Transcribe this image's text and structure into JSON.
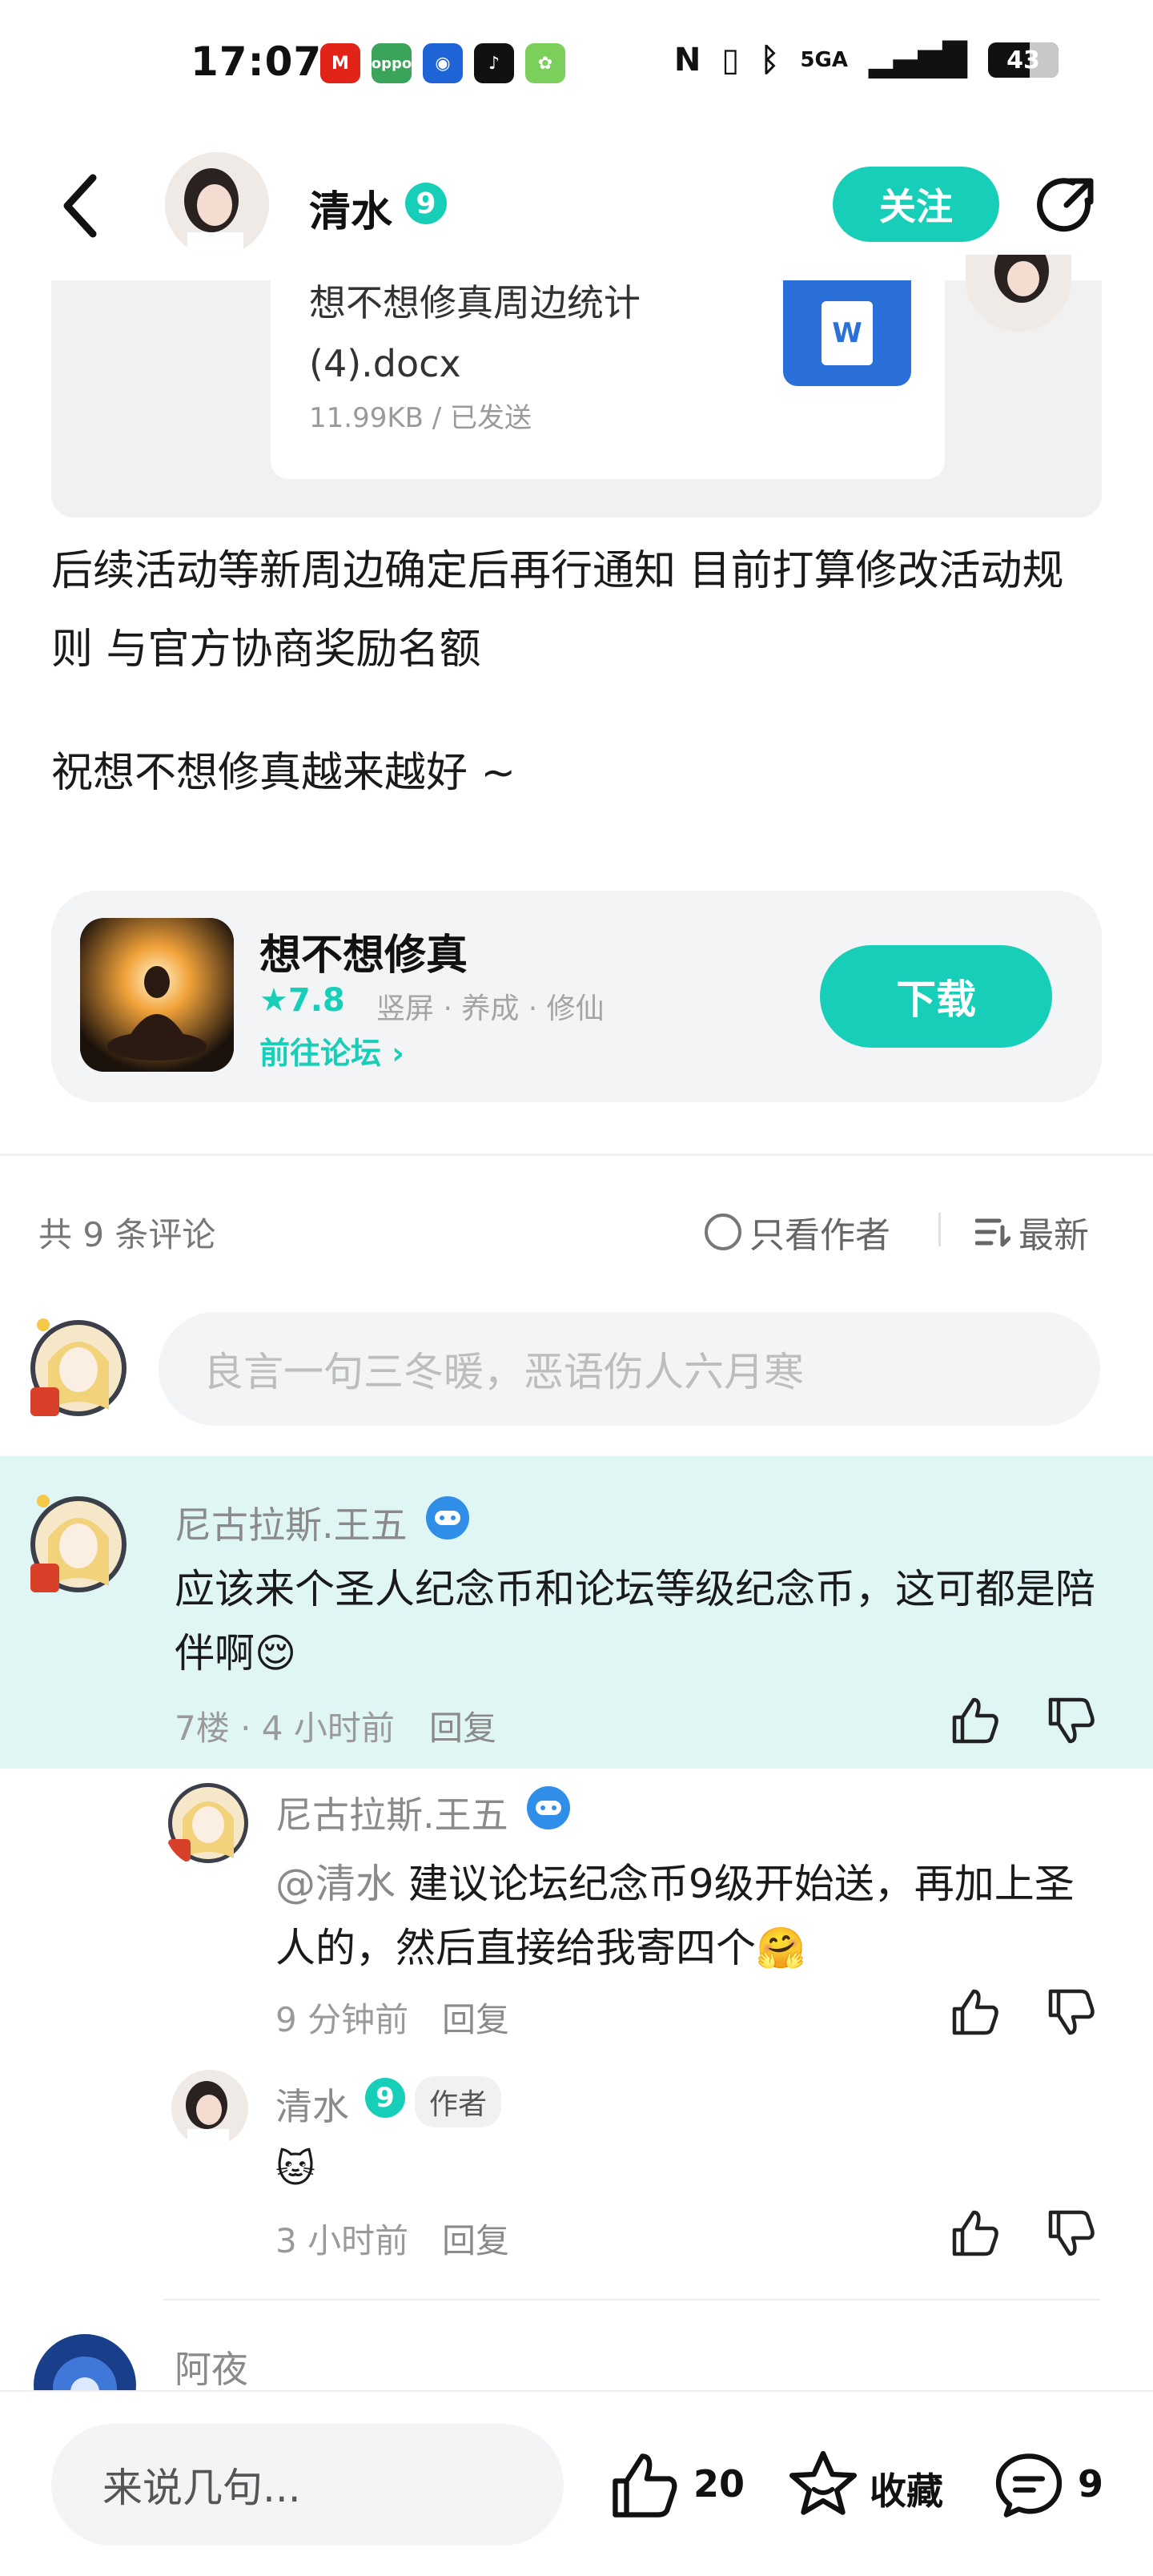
{
  "status_bar": {
    "time": "17:07",
    "apps": [
      {
        "name": "mcdonalds-icon",
        "color": "#e22318",
        "label": "M"
      },
      {
        "name": "oppo-icon",
        "color": "#3aa55a",
        "label": "oppo"
      },
      {
        "name": "alipay-ticket-icon",
        "color": "#1e64d6",
        "label": "◉"
      },
      {
        "name": "tiktok-icon",
        "color": "#111111",
        "label": "♪"
      },
      {
        "name": "game-app-icon",
        "color": "#7bcf5a",
        "label": "✿"
      }
    ],
    "network": "5GA",
    "battery": "43"
  },
  "header": {
    "author_name": "清水",
    "author_level": "9",
    "follow_label": "关注"
  },
  "attachment": {
    "file_name": "想不想修真周边统计(4).docx",
    "file_meta": "11.99KB / 已发送",
    "file_icon_letter": "W"
  },
  "post": {
    "paragraph_1": "后续活动等新周边确定后再行通知 目前打算修改活动规则 与官方协商奖励名额",
    "paragraph_2": "祝想不想修真越来越好 ~"
  },
  "game_card": {
    "name": "想不想修真",
    "rating": "★7.8",
    "tags": "竖屏 · 养成 · 修仙",
    "forum_link": "前往论坛 ›",
    "download_label": "下载"
  },
  "comments_header": {
    "count_text": "共 9 条评论",
    "only_author_label": "只看作者",
    "sort_label": "最新"
  },
  "comment_input": {
    "placeholder": "良言一句三冬暖，恶语伤人六月寒"
  },
  "comments": [
    {
      "name": "尼古拉斯.王五",
      "text": "应该来个圣人纪念币和论坛等级纪念币，这可都是陪伴啊😌",
      "meta": "7楼 · 4 小时前",
      "reply_label": "回复"
    }
  ],
  "replies": [
    {
      "name": "尼古拉斯.王五",
      "mention": "@清水",
      "text": "建议论坛纪念币9级开始送，再加上圣人的，然后直接给我寄四个🤗",
      "meta": "9 分钟前",
      "reply_label": "回复"
    },
    {
      "name": "清水",
      "level": "9",
      "author_tag": "作者",
      "sticker": "🐱",
      "meta": "3 小时前",
      "reply_label": "回复"
    }
  ],
  "next_comment": {
    "name": "阿夜"
  },
  "bottom_bar": {
    "input_placeholder": "来说几句...",
    "like_count": "20",
    "favorite_label": "收藏",
    "comment_count": "9"
  },
  "colors": {
    "accent": "#17cfb8",
    "highlight_bg": "#e0f6f4",
    "muted_text": "#9a9a9a"
  }
}
